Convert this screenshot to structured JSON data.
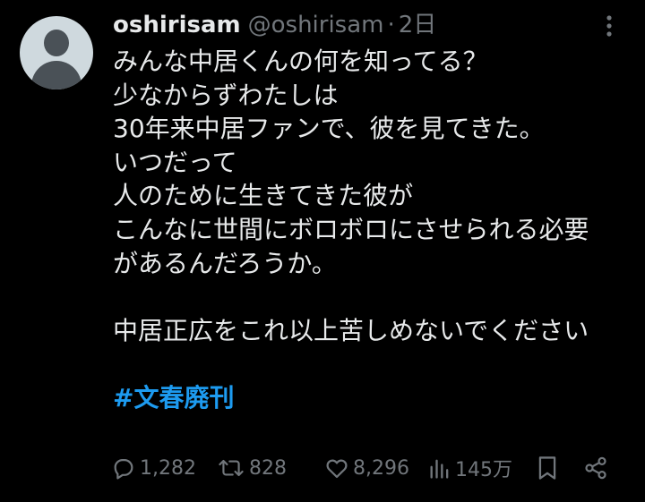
{
  "tweet": {
    "display_name": "oshirisam",
    "handle": "@oshirisam",
    "separator": "·",
    "time": "2日",
    "lines": [
      "みんな中居くんの何を知ってる？",
      "少なからずわたしは",
      "30年来中居ファンで、彼を見てきた。",
      "いつだって",
      "人のために生きてきた彼が",
      "こんなに世間にボロボロにさせられる必要",
      "があるんだろうか。",
      "中居正広をこれ以上苦しめないでください"
    ],
    "hashtag": "#文春廃刊"
  },
  "actions": {
    "reply": {
      "icon": "reply-icon",
      "count": "1,282"
    },
    "retweet": {
      "icon": "retweet-icon",
      "count": "828"
    },
    "like": {
      "icon": "heart-icon",
      "count": "8,296"
    },
    "views": {
      "icon": "views-icon",
      "count": "145万"
    },
    "bookmark": {
      "icon": "bookmark-icon"
    },
    "share": {
      "icon": "share-icon"
    }
  },
  "colors": {
    "background": "#000000",
    "text_primary": "#e7e9ea",
    "text_secondary": "#71767b",
    "accent": "#1d9bf0"
  }
}
